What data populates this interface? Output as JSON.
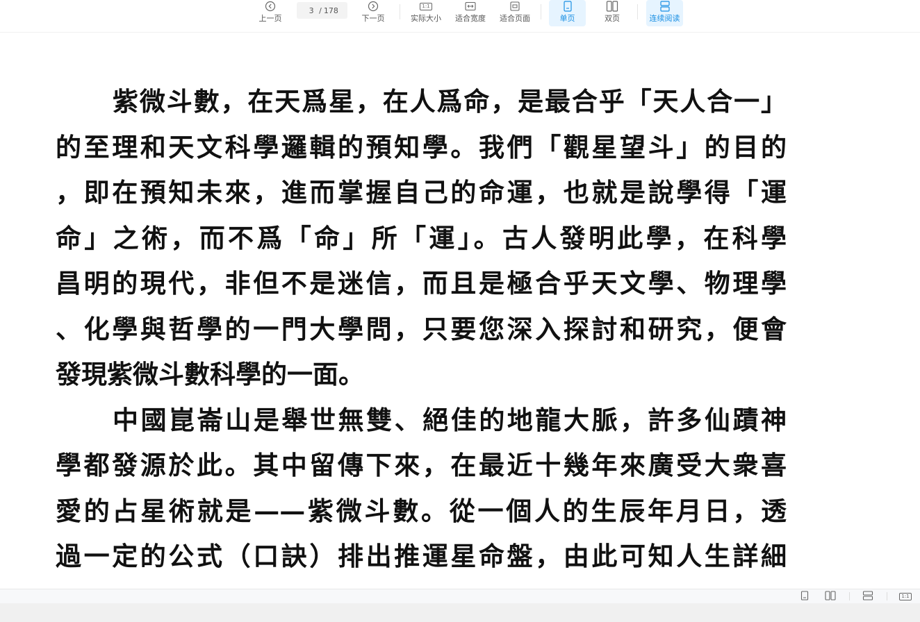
{
  "toolbar": {
    "prev_page": "上一页",
    "next_page": "下一页",
    "current_page": "3",
    "total_pages": "178",
    "actual_size": "实际大小",
    "actual_size_icon_text": "1:1",
    "fit_width": "适合宽度",
    "fit_page": "适合页面",
    "single_page": "单页",
    "double_page": "双页",
    "continuous": "连续阅读",
    "accent_color": "#1a8fe3"
  },
  "document": {
    "lines": [
      "紫微斗數，在天爲星，在人爲命，是最合乎「天人合一」",
      "的至理和天文科學邏輯的預知學。我們「觀星望斗」的目的",
      "，即在預知未來，進而掌握自己的命運，也就是說學得「運",
      "命」之術，而不爲「命」所「運」。古人發明此學，在科學",
      "昌明的現代，非但不是迷信，而且是極合乎天文學、物理學",
      "、化學與哲學的一門大學問，只要您深入探討和研究，便會",
      "發現紫微斗數科學的一面。",
      "中國崑崙山是舉世無雙、絕佳的地龍大脈，許多仙蹟神",
      "學都發源於此。其中留傳下來，在最近十幾年來廣受大衆喜",
      "愛的占星術就是——紫微斗數。從一個人的生辰年月日，透",
      "過一定的公式（口訣）排出推運星命盤，由此可知人生詳細"
    ]
  },
  "statusbar": {
    "zoom_icon_text": "1:1"
  }
}
